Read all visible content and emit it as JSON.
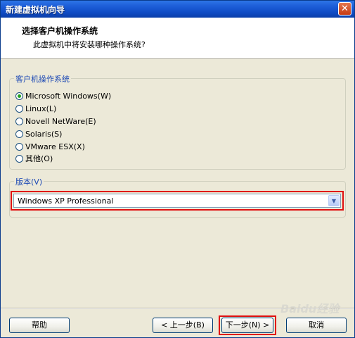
{
  "window": {
    "title": "新建虚拟机向导",
    "close_glyph": "✕"
  },
  "header": {
    "title": "选择客户机操作系统",
    "subtitle": "此虚拟机中将安装哪种操作系统?"
  },
  "os_group": {
    "legend": "客户机操作系统",
    "options": [
      {
        "label": "Microsoft Windows(W)",
        "selected": true
      },
      {
        "label": "Linux(L)",
        "selected": false
      },
      {
        "label": "Novell NetWare(E)",
        "selected": false
      },
      {
        "label": "Solaris(S)",
        "selected": false
      },
      {
        "label": "VMware ESX(X)",
        "selected": false
      },
      {
        "label": "其他(O)",
        "selected": false
      }
    ]
  },
  "version_group": {
    "legend": "版本(V)",
    "selected": "Windows XP Professional",
    "arrow_glyph": "▼"
  },
  "buttons": {
    "help": "帮助",
    "back": "< 上一步(B)",
    "next": "下一步(N) >",
    "cancel": "取消"
  },
  "watermark": "Baidu经验",
  "colors": {
    "titlebar": "#0a3ea8",
    "highlight": "#e01010",
    "legend_text": "#1a47b4",
    "dialog_bg": "#ece9d8"
  }
}
